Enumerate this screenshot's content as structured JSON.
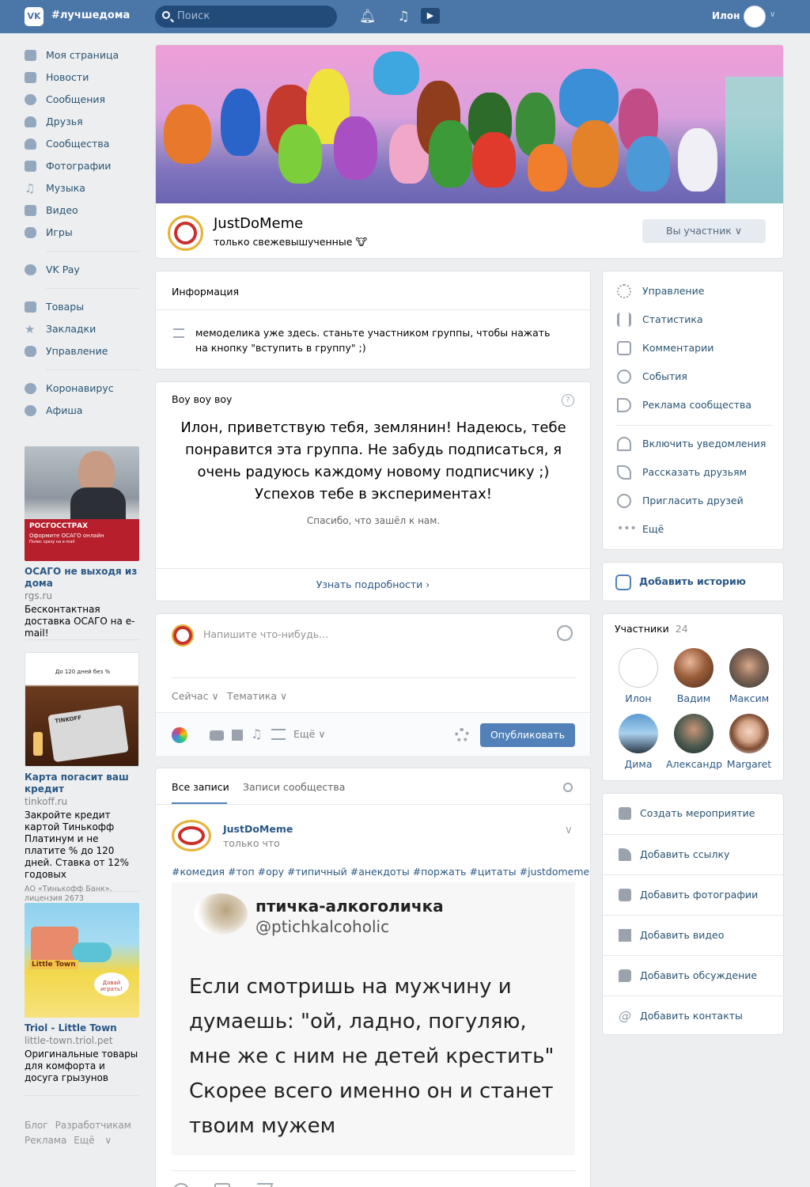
{
  "header": {
    "logo": "VK",
    "hashtag": "#лучшедома",
    "search_placeholder": "Поиск",
    "user_name": "Илон",
    "icons": [
      "bell-icon",
      "music-icon",
      "play-icon"
    ]
  },
  "left_nav": {
    "items": [
      {
        "label": "Моя страница",
        "icon": "home-icon"
      },
      {
        "label": "Новости",
        "icon": "news-icon"
      },
      {
        "label": "Сообщения",
        "icon": "messages-icon"
      },
      {
        "label": "Друзья",
        "icon": "friend-icon"
      },
      {
        "label": "Сообщества",
        "icon": "groups-icon"
      },
      {
        "label": "Фотографии",
        "icon": "camera-icon"
      },
      {
        "label": "Музыка",
        "icon": "music-icon"
      },
      {
        "label": "Видео",
        "icon": "video-icon"
      },
      {
        "label": "Игры",
        "icon": "gamepad-icon"
      }
    ],
    "vkpay": "VK Pay",
    "extra": [
      {
        "label": "Товары",
        "icon": "bag-icon"
      },
      {
        "label": "Закладки",
        "icon": "star-icon"
      },
      {
        "label": "Управление",
        "icon": "gamepad-icon"
      }
    ],
    "corona": "Коронавирус",
    "afisha": "Афиша"
  },
  "ads": [
    {
      "title": "ОСАГО не выходя из дома",
      "domain": "rgs.ru",
      "text": "Бесконтактная доставка ОСАГО на e-mail!",
      "license": "",
      "img_text": [
        "РОСГОССТРАХ",
        "Оформите ОСАГО онлайн",
        "Полис сразу на e-mail"
      ]
    },
    {
      "title": "Карта погасит ваш кредит",
      "domain": "tinkoff.ru",
      "text": "Закройте кредит картой Тинькофф Платинум и не платите % до 120 дней. Ставка от 12% годовых",
      "license": "АО «Тинькофф Банк», лицензия 2673",
      "img_text": [
        "До 120 дней без %",
        "TINKOFF"
      ]
    },
    {
      "title": "Triol - Little Town",
      "domain": "little-town.triol.pet",
      "text": "Оригинальные товары для комфорта и досуга грызунов",
      "license": "",
      "img_text": [
        "Little Town",
        "Давай играть!"
      ]
    }
  ],
  "footer": {
    "links": [
      "Блог",
      "Разработчикам",
      "Реклама",
      "Ещё"
    ]
  },
  "group": {
    "name": "JustDoMeme",
    "status": "только свежевышученные",
    "member_button": "Вы участник"
  },
  "info": {
    "title": "Информация",
    "description": "мемоделика уже здесь. станьте участником группы, чтобы нажать на кнопку \"вступить в группу\" ;)"
  },
  "welcome": {
    "title": "Воу воу воу",
    "text": "Илон, приветствую тебя, землянин! Надеюсь, тебе понравится эта группа. Не забудь подписаться, я очень радуюсь каждому новому подписчику ;) Успехов тебе в экспериментах!",
    "subtext": "Спасибо, что зашёл к нам.",
    "link": "Узнать подробности"
  },
  "composer": {
    "placeholder": "Напишите что-нибудь...",
    "time": "Сейчас",
    "theme": "Тематика",
    "more": "Ещё",
    "publish": "Опубликовать"
  },
  "wall": {
    "tabs": [
      "Все записи",
      "Записи сообщества"
    ],
    "post": {
      "author": "JustDoMeme",
      "time": "только что",
      "tags": "#комедия #топ #ору #типичный #анекдоты #поржать #цитаты #justdomeme",
      "meme_name": "птичка-алкоголичка",
      "meme_handle": "@ptichkalcoholic",
      "meme_text": "Если смотришь на мужчину и думаешь: \"ой, ладно, погуляю, мне же с ним не детей крестить\" Скорее всего именно он и станет твоим мужем"
    }
  },
  "right_menu": {
    "admin": [
      {
        "label": "Управление",
        "icon": "gear-icon"
      },
      {
        "label": "Статистика",
        "icon": "stats-icon"
      },
      {
        "label": "Комментарии",
        "icon": "comment-icon"
      },
      {
        "label": "События",
        "icon": "events-icon"
      },
      {
        "label": "Реклама сообщества",
        "icon": "megaphone-icon"
      }
    ],
    "actions": [
      {
        "label": "Включить уведомления",
        "icon": "bell-icon"
      },
      {
        "label": "Рассказать друзьям",
        "icon": "share-icon"
      },
      {
        "label": "Пригласить друзей",
        "icon": "add-user-icon"
      },
      {
        "label": "Ещё",
        "icon": "more-icon"
      }
    ]
  },
  "story": "Добавить историю",
  "members": {
    "title": "Участники",
    "count": "24",
    "list": [
      "Илон",
      "Вадим",
      "Максим",
      "Дима",
      "Александр",
      "Margaret"
    ]
  },
  "add_actions": [
    {
      "label": "Создать мероприятие",
      "icon": "calendar-icon"
    },
    {
      "label": "Добавить ссылку",
      "icon": "link-icon"
    },
    {
      "label": "Добавить фотографии",
      "icon": "camera-icon"
    },
    {
      "label": "Добавить видео",
      "icon": "video-icon"
    },
    {
      "label": "Добавить обсуждение",
      "icon": "discussion-icon"
    },
    {
      "label": "Добавить контакты",
      "icon": "at-icon"
    }
  ],
  "colors": {
    "header": "#4a76a8",
    "link": "#2a5885",
    "button": "#5181b8",
    "background": "#edeef0"
  }
}
